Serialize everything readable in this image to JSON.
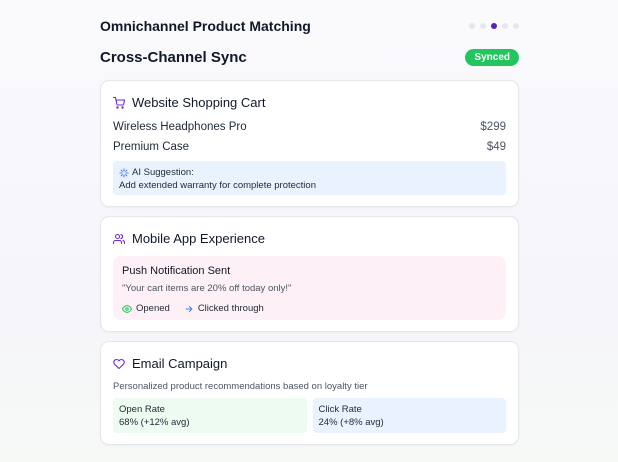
{
  "app": {
    "title": "Omnichannel Product Matching"
  },
  "pager": {
    "total": 5,
    "active_index": 2
  },
  "section": {
    "title": "Cross-Channel Sync",
    "status": "Synced"
  },
  "colors": {
    "accent": "#5b21b6",
    "success": "#22c55e"
  },
  "website_card": {
    "title": "Website Shopping Cart",
    "icon": "shopping-cart-icon",
    "items": [
      {
        "name": "Wireless Headphones Pro",
        "price": "$299"
      },
      {
        "name": "Premium Case",
        "price": "$49"
      }
    ],
    "suggestion": {
      "title": "AI Suggestion:",
      "text": "Add extended warranty for complete protection"
    }
  },
  "mobile_card": {
    "title": "Mobile App Experience",
    "icon": "users-icon",
    "push": {
      "title": "Push Notification Sent",
      "message": "\"Your cart items are 20% off today only!\"",
      "stat_opened": "Opened",
      "stat_clicked": "Clicked through"
    }
  },
  "email_card": {
    "title": "Email Campaign",
    "icon": "heart-icon",
    "description": "Personalized product recommendations based on loyalty tier",
    "metrics": [
      {
        "label": "Open Rate",
        "value": "68% (+12% avg)"
      },
      {
        "label": "Click Rate",
        "value": "24% (+8% avg)"
      }
    ]
  }
}
